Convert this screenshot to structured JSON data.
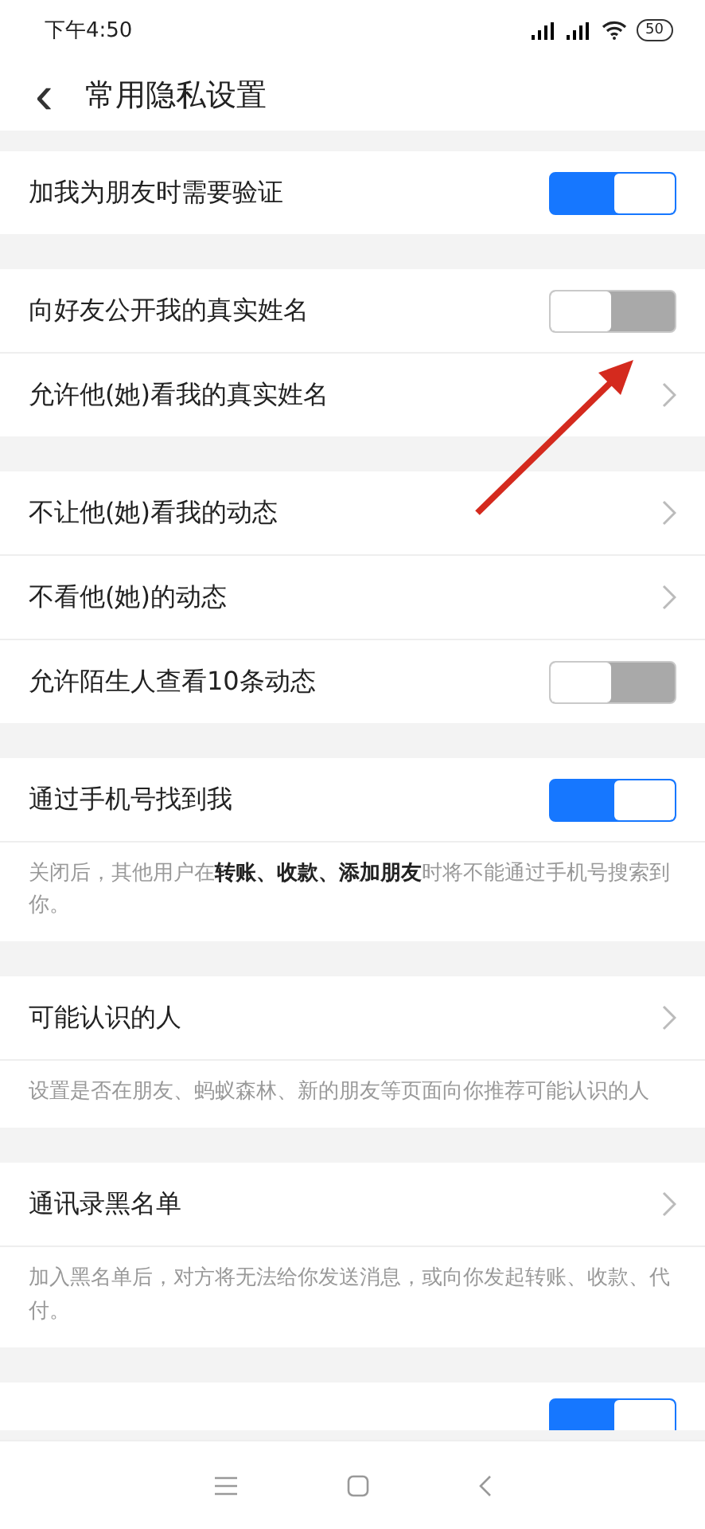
{
  "status_bar": {
    "time": "下午4:50",
    "battery": "50"
  },
  "header": {
    "back": "‹",
    "title": "常用隐私设置"
  },
  "sections": [
    {
      "rows": [
        {
          "kind": "toggle",
          "label": "加我为朋友时需要验证",
          "on": true
        }
      ]
    },
    {
      "rows": [
        {
          "kind": "toggle",
          "label": "向好友公开我的真实姓名",
          "on": false
        },
        {
          "kind": "link",
          "label": "允许他(她)看我的真实姓名"
        }
      ]
    },
    {
      "rows": [
        {
          "kind": "link",
          "label": "不让他(她)看我的动态"
        },
        {
          "kind": "link",
          "label": "不看他(她)的动态"
        },
        {
          "kind": "toggle",
          "label": "允许陌生人查看10条动态",
          "on": false
        }
      ]
    },
    {
      "rows": [
        {
          "kind": "toggle",
          "label": "通过手机号找到我",
          "on": true
        }
      ],
      "note": "关闭后，其他用户在**转账、收款、添加朋友**时将不能通过手机号搜索到你。"
    },
    {
      "rows": [
        {
          "kind": "link",
          "label": "可能认识的人"
        }
      ],
      "note": "设置是否在朋友、蚂蚁森林、新的朋友等页面向你推荐可能认识的人"
    },
    {
      "rows": [
        {
          "kind": "link",
          "label": "通讯录黑名单"
        }
      ],
      "note": "加入黑名单后，对方将无法给你发送消息，或向你发起转账、收款、代付。"
    },
    {
      "rows": [
        {
          "kind": "toggle",
          "on": true
        }
      ]
    }
  ],
  "annotation": {
    "kind": "arrow"
  }
}
